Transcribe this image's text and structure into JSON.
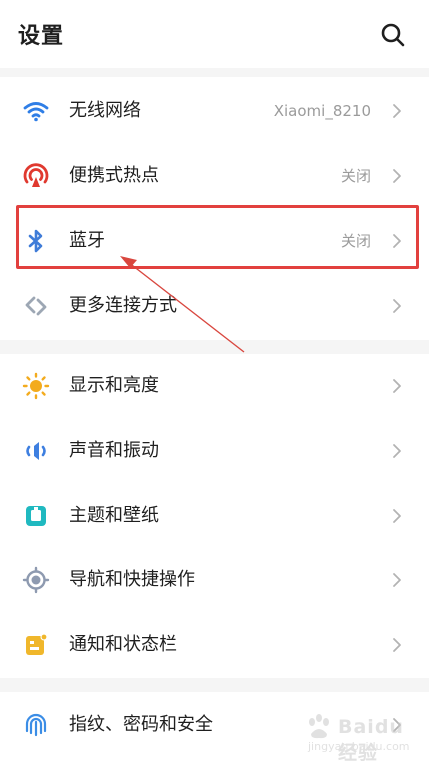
{
  "header": {
    "title": "设置",
    "search_icon": "search-icon"
  },
  "settings": [
    {
      "id": "wifi",
      "label": "无线网络",
      "value": "Xiaomi_8210",
      "icon": "wifi-icon",
      "color": "#2f7ee6"
    },
    {
      "id": "hotspot",
      "label": "便携式热点",
      "value": "关闭",
      "icon": "hotspot-icon",
      "color": "#e0392f"
    },
    {
      "id": "bluetooth",
      "label": "蓝牙",
      "value": "关闭",
      "icon": "bluetooth-icon",
      "color": "#3f7cd8"
    },
    {
      "id": "more-connections",
      "label": "更多连接方式",
      "value": "",
      "icon": "link-icon",
      "color": "#9da7b4"
    },
    {
      "id": "display",
      "label": "显示和亮度",
      "value": "",
      "icon": "sun-icon",
      "color": "#f3ab1d"
    },
    {
      "id": "sound",
      "label": "声音和振动",
      "value": "",
      "icon": "speaker-icon",
      "color": "#3e7fe0"
    },
    {
      "id": "theme",
      "label": "主题和壁纸",
      "value": "",
      "icon": "theme-icon",
      "color": "#20b9c0"
    },
    {
      "id": "navigation",
      "label": "导航和快捷操作",
      "value": "",
      "icon": "navigation-icon",
      "color": "#8e9ab0"
    },
    {
      "id": "notifications",
      "label": "通知和状态栏",
      "value": "",
      "icon": "notification-icon",
      "color": "#f0b72b"
    },
    {
      "id": "security",
      "label": "指纹、密码和安全",
      "value": "",
      "icon": "fingerprint-icon",
      "color": "#3b8de6"
    }
  ],
  "annotation": {
    "highlighted_item": "bluetooth",
    "color": "#e2403e"
  },
  "watermark": {
    "main": "Baidu经验",
    "sub": "jingyan.baidu.com"
  }
}
